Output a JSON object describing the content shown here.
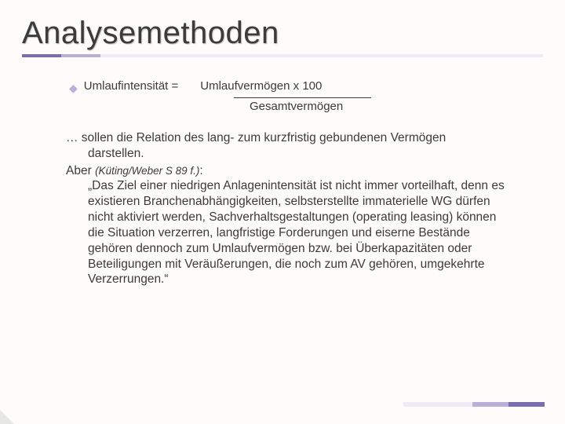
{
  "title": "Analysemethoden",
  "bullet": {
    "label": "Umlaufintensität =",
    "numerator": "Umlaufvermögen x 100",
    "denominator": "Gesamtvermögen"
  },
  "relation": {
    "lead": "… sollen die Relation des lang- zum kurzfristig gebundenen Vermögen",
    "cont": "darstellen."
  },
  "aber": {
    "label": "Aber ",
    "cite": "(Küting/Weber S 89 f.)",
    "colon": ":",
    "body": "„Das Ziel einer niedrigen Anlagenintensität ist nicht immer vorteilhaft, denn es existieren Branchenabhängigkeiten, selbsterstellte immaterielle WG dürfen nicht aktiviert werden, Sachverhaltsgestaltungen (operating leasing) können die Situation verzerren, langfristige Forderungen und eiserne Bestände gehören dennoch zum Umlaufvermögen bzw. bei Überkapazitäten oder Beteiligungen mit Veräußerungen, die noch zum AV gehören, umgekehrte Verzerrungen.“"
  }
}
